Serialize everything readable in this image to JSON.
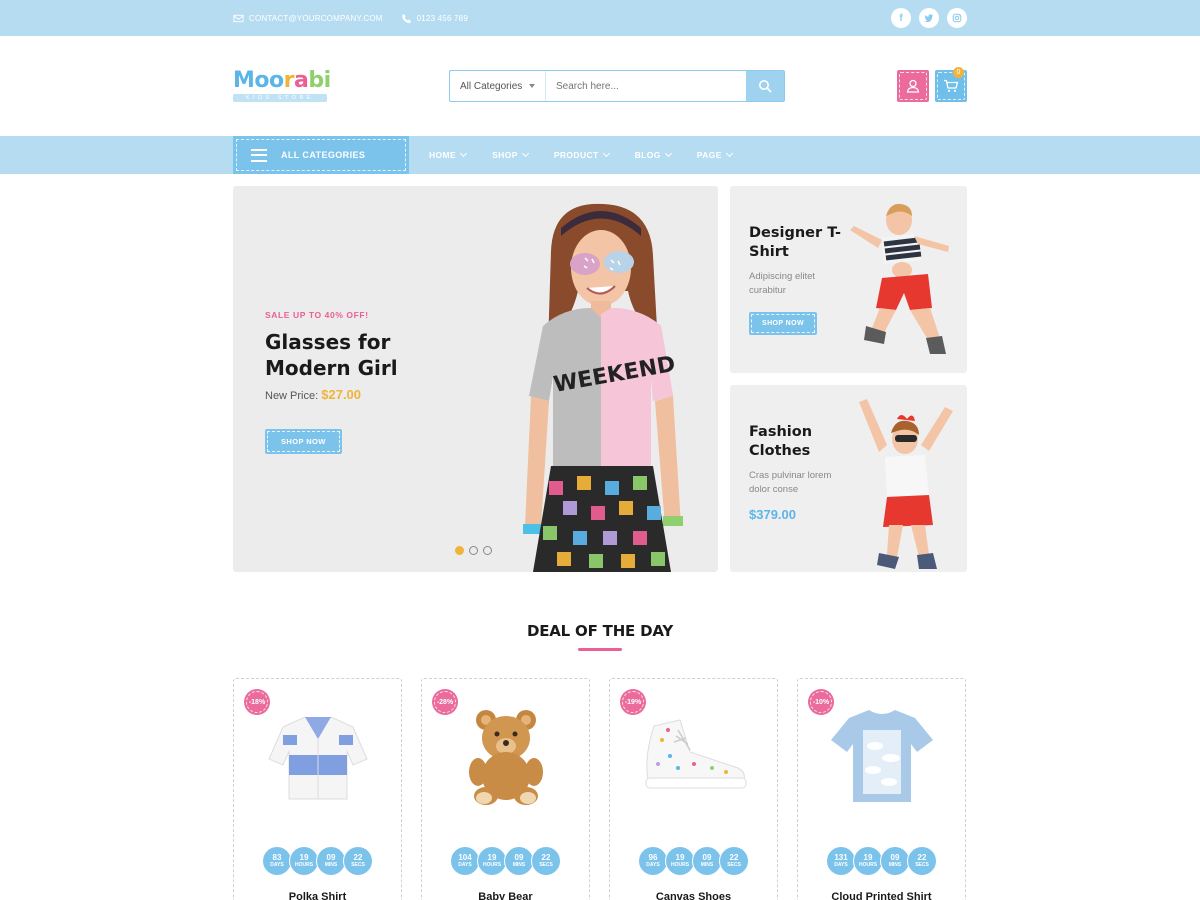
{
  "topbar": {
    "email": "CONTACT@YOURCOMPANY.COM",
    "phone": "0123 456 789",
    "socials": [
      "f",
      "t",
      "ig"
    ]
  },
  "header": {
    "logo": {
      "letters": [
        "Moo",
        "r",
        "a",
        "bi"
      ],
      "tagline": "KIDS STORE"
    },
    "search": {
      "category": "All Categories",
      "placeholder": "Search here..."
    },
    "cart_count": "0"
  },
  "nav": {
    "all_categories": "ALL CATEGORIES",
    "items": [
      "HOME",
      "SHOP",
      "PRODUCT",
      "BLOG",
      "PAGE"
    ]
  },
  "hero": {
    "sale": "SALE UP TO 40% OFF!",
    "title_line1": "Glasses for",
    "title_line2": "Modern Girl",
    "price_label": "New Price:",
    "price": "$27.00",
    "button": "SHOP NOW",
    "shirt_text": "WEEKEND",
    "slides": 3,
    "active_slide": 1
  },
  "side_banners": [
    {
      "title_line1": "Designer T-",
      "title_line2": "Shirt",
      "desc_line1": "Adipiscing elitet",
      "desc_line2": "curabitur",
      "button": "SHOP NOW"
    },
    {
      "title_line1": "Fashion",
      "title_line2": "Clothes",
      "desc_line1": "Cras pulvinar lorem",
      "desc_line2": "dolor conse",
      "price": "$379.00"
    }
  ],
  "deal": {
    "title": "DEAL OF THE DAY",
    "units": [
      "DAYS",
      "HOURS",
      "MINS",
      "SECS"
    ],
    "products": [
      {
        "badge": "-18%",
        "timer": [
          "83",
          "19",
          "09",
          "22"
        ],
        "name": "Polka Shirt",
        "image": "shirt"
      },
      {
        "badge": "-28%",
        "timer": [
          "104",
          "19",
          "09",
          "22"
        ],
        "name": "Baby Bear",
        "image": "teddy-bear"
      },
      {
        "badge": "-19%",
        "timer": [
          "96",
          "19",
          "09",
          "22"
        ],
        "name": "Canvas Shoes",
        "image": "sneaker"
      },
      {
        "badge": "-10%",
        "timer": [
          "131",
          "19",
          "09",
          "22"
        ],
        "name": "Cloud Printed Shirt",
        "image": "tshirt"
      }
    ]
  },
  "colors": {
    "accent_blue": "#7cc3ec",
    "light_blue": "#b6dcf1",
    "pink": "#ea6b9c",
    "yellow": "#f0b43a"
  }
}
